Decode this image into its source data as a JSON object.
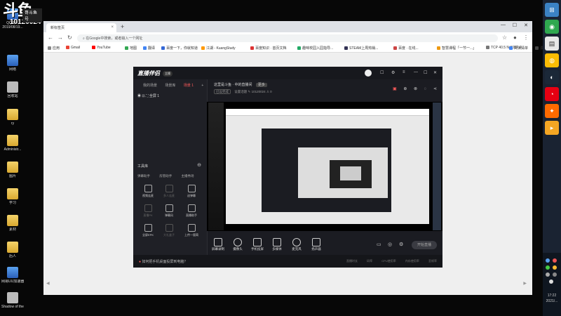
{
  "overlay": {
    "logo_main": "斗鱼",
    "logo_sub": "哥斗鱼号",
    "room_id": "10120024"
  },
  "desktop": {
    "icons": [
      {
        "label": "QQ游戏",
        "sub": "2019/08/19..."
      },
      {
        "label": "网络"
      },
      {
        "label": "回收站"
      },
      {
        "label": "ry"
      },
      {
        "label": "Administr..."
      },
      {
        "label": "图片"
      },
      {
        "label": "学习"
      },
      {
        "label": "素材"
      },
      {
        "label": "后人"
      },
      {
        "label": "网易UU加速器"
      },
      {
        "label": "Shadow of the Tom..."
      }
    ]
  },
  "browser": {
    "tab_title": "新标签页",
    "tab_close": "×",
    "new_tab": "+",
    "omnibox_placeholder": "在Google中搜索，或者输入一个网址",
    "bookmarks": [
      "应用",
      "Gmail",
      "YouTube",
      "地图",
      "翻译",
      "百度一下，你就知道",
      "江湖 - KuangStudy",
      "百度知识 · 首页文档",
      "趣味校园入园指导...",
      "STEAM上周热销...",
      "百度 · 在线...",
      "智慧课程「一节一...」",
      "TCP 40.5 N 30BP 0...",
      "漫画人 - 佳能人人享...",
      "阅读清单"
    ],
    "scroll_left": "◀",
    "scroll_right": "▶"
  },
  "app": {
    "brand": "直播伴侣",
    "brand_pill": "主播",
    "sidebar_tabs": [
      "我的场景",
      "场景库",
      "场景 1"
    ],
    "scene_label": "全屏 1",
    "tools_title": "工具库",
    "tools_categories": [
      "弹幕助手",
      "房管助手",
      "主播秀场"
    ],
    "tools": [
      {
        "label": "视频连麦",
        "dim": false
      },
      {
        "label": "多人连麦",
        "dim": true
      },
      {
        "label": "送弹幕",
        "dim": false
      },
      {
        "label": "直播PK",
        "dim": true
      },
      {
        "label": "弹幕风",
        "dim": false
      },
      {
        "label": "直播助手",
        "dim": false
      },
      {
        "label": "全屏EPK",
        "dim": false
      },
      {
        "label": "大礼盒子",
        "dim": true
      },
      {
        "label": "上传一版简",
        "dim": false
      }
    ],
    "main_title": "这里是斗鱼 · 中的直播间",
    "main_tag": "更多",
    "main_sub_btn": "已设完成",
    "main_sub_text": "设置话题",
    "room_id": "10120024",
    "bottom_items": [
      "屏幕录制",
      "摄像头",
      "手机投屏",
      "多媒体",
      "麦克风",
      "扬声器"
    ],
    "start_button": "开始直播",
    "status_left": "如何把手机桌面投屏到电脑？",
    "status_right": [
      "直播时长",
      "码率",
      "CPU使用率",
      "内存使用率",
      "丢帧率"
    ]
  },
  "taskbar": {
    "time": "17:22",
    "date": "2021/..."
  },
  "colors": {
    "accent": "#ff5b5b",
    "app_bg": "#1b1c22",
    "browser_bg": "#efefef"
  }
}
